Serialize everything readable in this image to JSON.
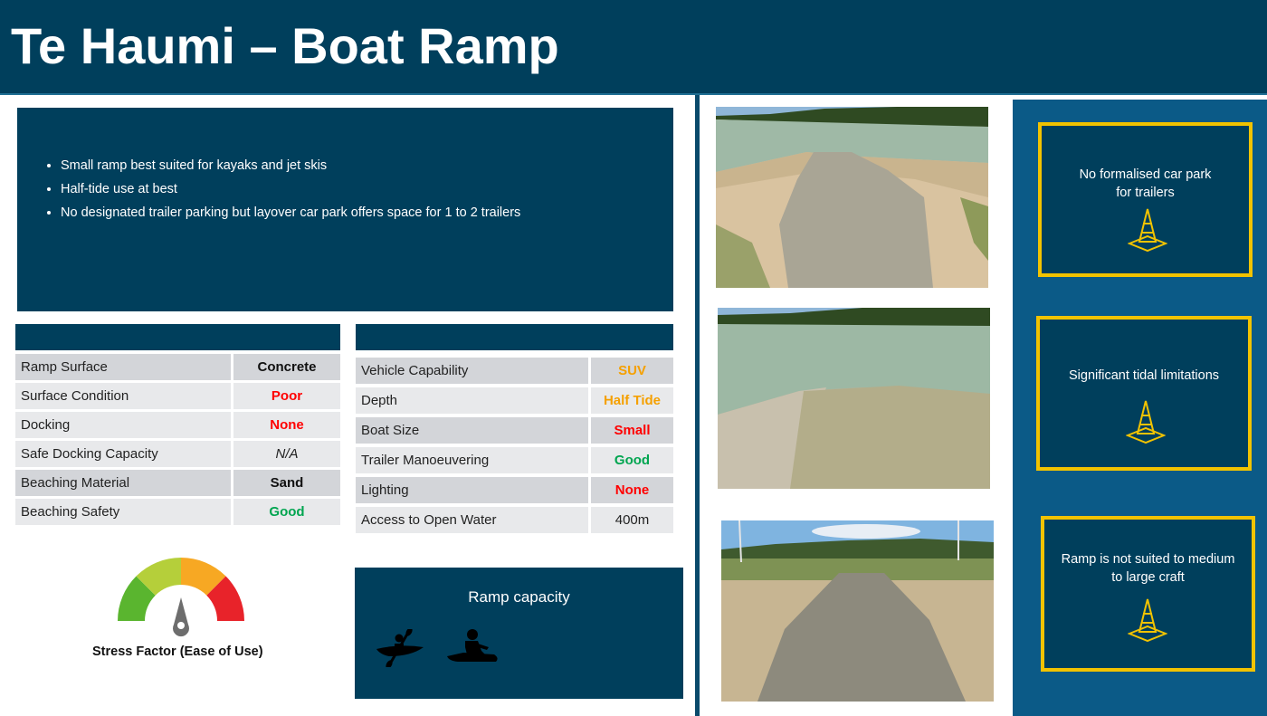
{
  "header": {
    "title": "Te Haumi – Boat Ramp"
  },
  "summary": {
    "bullets": [
      "Small ramp best suited for kayaks and jet skis",
      "Half-tide use at best",
      "No designated trailer parking but layover car park offers space for 1 to 2 trailers"
    ]
  },
  "left_table": {
    "rows": [
      {
        "label": "Ramp Surface",
        "value": "Concrete",
        "color": "#111111"
      },
      {
        "label": "Surface Condition",
        "value": "Poor",
        "color": "#ff0000"
      },
      {
        "label": "Docking",
        "value": "None",
        "color": "#ff0000"
      },
      {
        "label": "Safe Docking Capacity",
        "value": "N/A",
        "color": "#222222"
      },
      {
        "label": "Beaching Material",
        "value": "Sand",
        "color": "#111111"
      },
      {
        "label": "Beaching Safety",
        "value": "Good",
        "color": "#00a550"
      }
    ]
  },
  "right_table": {
    "rows": [
      {
        "label": "Vehicle Capability",
        "value": "SUV",
        "color": "#f5a000"
      },
      {
        "label": "Depth",
        "value": "Half Tide",
        "color": "#f5a000"
      },
      {
        "label": "Boat Size",
        "value": "Small",
        "color": "#ff0000"
      },
      {
        "label": "Trailer Manoeuvering",
        "value": "Good",
        "color": "#00a550"
      },
      {
        "label": "Lighting",
        "value": "None",
        "color": "#ff0000"
      },
      {
        "label": "Access to Open Water",
        "value": "400m",
        "color": "#222222"
      }
    ]
  },
  "stress": {
    "label": "Stress Factor (Ease of Use)",
    "gauge_colors": [
      "#5ab52f",
      "#b5cf3a",
      "#f7a823",
      "#e8232a"
    ]
  },
  "capacity": {
    "title": "Ramp capacity",
    "icons": [
      "kayak-icon",
      "jet-ski-icon"
    ]
  },
  "warnings": [
    {
      "line1": "No formalised car park",
      "line2": "for trailers",
      "icon": "traffic-cone-icon"
    },
    {
      "line1": "Significant tidal limitations",
      "line2": "",
      "icon": "traffic-cone-icon"
    },
    {
      "line1": "Ramp is not suited to medium",
      "line2": "to large craft",
      "icon": "traffic-cone-icon"
    }
  ],
  "colors": {
    "navy": "#003f5c",
    "panel_blue": "#0b5a87",
    "warning_border": "#f2c300"
  }
}
